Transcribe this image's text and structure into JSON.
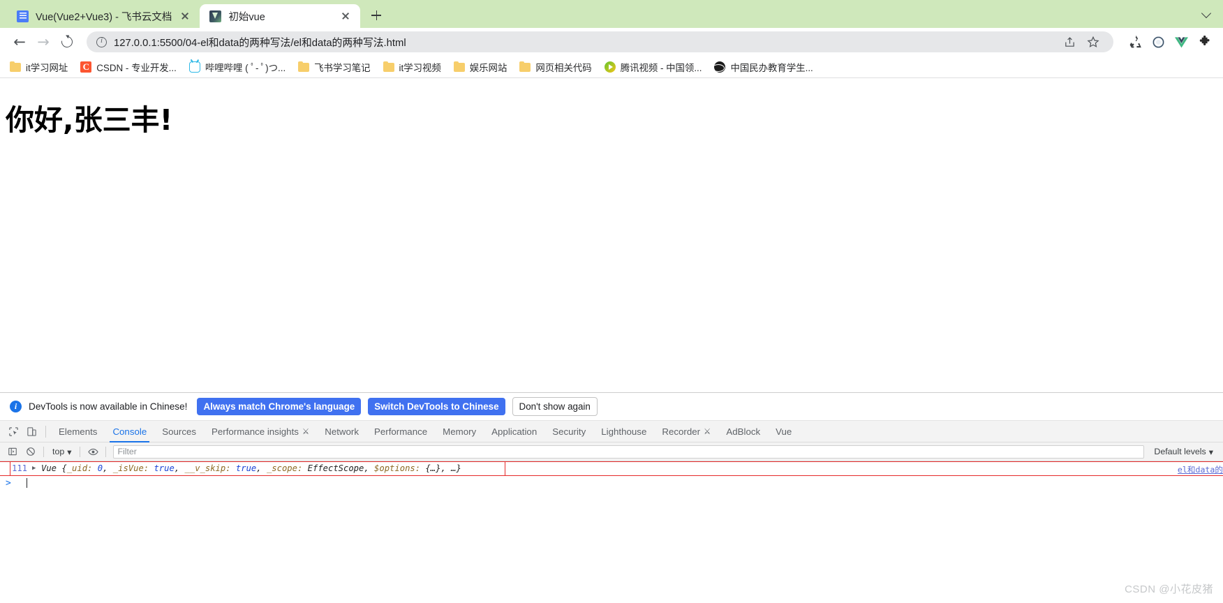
{
  "window": {
    "minimize_chevron": "chevron-down"
  },
  "tabs": [
    {
      "title": "Vue(Vue2+Vue3) - 飞书云文档",
      "favicon": "docs-icon",
      "active": false
    },
    {
      "title": "初始vue",
      "favicon": "vue-icon",
      "active": true
    }
  ],
  "toolbar": {
    "back": "←",
    "forward": "→",
    "reload": "reload-icon",
    "url": "127.0.0.1:5500/04-el和data的两种写法/el和data的两种写法.html",
    "site_info_icon": "info-circle-icon",
    "share_icon": "share-icon",
    "bookmark_icon": "star-icon",
    "extensions": [
      "recycle-icon",
      "o-circle-icon",
      "vue-logo-icon",
      "puzzle-icon"
    ]
  },
  "bookmarks": [
    {
      "label": "it学习网址",
      "icon": "folder-icon"
    },
    {
      "label": "CSDN - 专业开发...",
      "icon": "csdn-icon"
    },
    {
      "label": "哔哩哔哩 ( ﾟ- ﾟ)つ...",
      "icon": "bilibili-icon"
    },
    {
      "label": "飞书学习笔记",
      "icon": "folder-icon"
    },
    {
      "label": "it学习视频",
      "icon": "folder-icon"
    },
    {
      "label": "娱乐网站",
      "icon": "folder-icon"
    },
    {
      "label": "网页相关代码",
      "icon": "folder-icon"
    },
    {
      "label": "腾讯视频 - 中国领...",
      "icon": "tencent-video-icon"
    },
    {
      "label": "中国民办教育学生...",
      "icon": "globe-icon"
    }
  ],
  "page": {
    "heading": "你好,张三丰!"
  },
  "devtools": {
    "notice": {
      "message": "DevTools is now available in Chinese!",
      "buttons": [
        {
          "label": "Always match Chrome's language",
          "style": "primary"
        },
        {
          "label": "Switch DevTools to Chinese",
          "style": "primary"
        },
        {
          "label": "Don't show again",
          "style": "plain"
        }
      ]
    },
    "panel_tabs": [
      {
        "label": "Elements",
        "selected": false,
        "flask": false
      },
      {
        "label": "Console",
        "selected": true,
        "flask": false
      },
      {
        "label": "Sources",
        "selected": false,
        "flask": false
      },
      {
        "label": "Performance insights",
        "selected": false,
        "flask": true
      },
      {
        "label": "Network",
        "selected": false,
        "flask": false
      },
      {
        "label": "Performance",
        "selected": false,
        "flask": false
      },
      {
        "label": "Memory",
        "selected": false,
        "flask": false
      },
      {
        "label": "Application",
        "selected": false,
        "flask": false
      },
      {
        "label": "Security",
        "selected": false,
        "flask": false
      },
      {
        "label": "Lighthouse",
        "selected": false,
        "flask": false
      },
      {
        "label": "Recorder",
        "selected": false,
        "flask": true
      },
      {
        "label": "AdBlock",
        "selected": false,
        "flask": false
      },
      {
        "label": "Vue",
        "selected": false,
        "flask": false
      }
    ],
    "filterbar": {
      "sidebar_toggle_icon": "sidebar-icon",
      "clear_icon": "clear-console-icon",
      "context": "top",
      "eye_icon": "live-expression-icon",
      "filter_placeholder": "Filter",
      "filter_value": "",
      "levels": "Default levels"
    },
    "console": {
      "log": {
        "count": "111",
        "disclosure": "▶",
        "constructor": "Vue",
        "text": "{_uid: 0, _isVue: true, __v_skip: true, _scope: EffectScope, $options: {…}, …}",
        "tokens": [
          {
            "t": "Vue ",
            "k": "cls"
          },
          {
            "t": "{",
            "k": "pun"
          },
          {
            "t": "_uid: ",
            "k": "key"
          },
          {
            "t": "0",
            "k": "val"
          },
          {
            "t": ", ",
            "k": "pun"
          },
          {
            "t": "_isVue: ",
            "k": "key"
          },
          {
            "t": "true",
            "k": "val"
          },
          {
            "t": ", ",
            "k": "pun"
          },
          {
            "t": "__v_skip: ",
            "k": "key"
          },
          {
            "t": "true",
            "k": "val"
          },
          {
            "t": ", ",
            "k": "pun"
          },
          {
            "t": "_scope: ",
            "k": "key"
          },
          {
            "t": "EffectScope",
            "k": "cls"
          },
          {
            "t": ", ",
            "k": "pun"
          },
          {
            "t": "$options: ",
            "k": "key"
          },
          {
            "t": "{…}",
            "k": "pun"
          },
          {
            "t": ", …}",
            "k": "pun"
          }
        ],
        "source": "el和data的"
      },
      "prompt_caret": ">"
    }
  },
  "watermark": "CSDN @小花皮猪",
  "colors": {
    "tabstrip": "#cfe8bb",
    "accent_blue": "#1a73e8",
    "button_blue": "#4071f0",
    "error_red": "#e52a2a"
  }
}
